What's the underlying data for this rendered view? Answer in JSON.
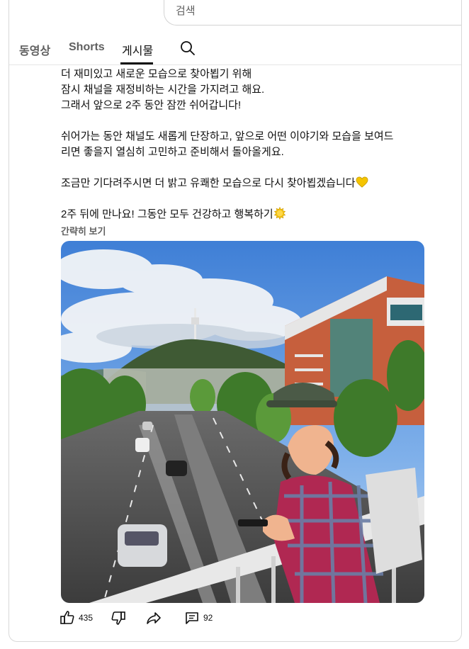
{
  "search": {
    "placeholder": "검색"
  },
  "tabs": [
    {
      "label": "동영상",
      "active": false
    },
    {
      "label": "Shorts",
      "active": false
    },
    {
      "label": "게시물",
      "active": true
    }
  ],
  "post": {
    "paragraph1": "더 재미있고 새로운 모습으로 찾아뵙기 위해\n잠시 채널을 재정비하는 시간을 가지려고 해요.\n그래서 앞으로 2주 동안 잠깐 쉬어갑니다!",
    "paragraph2": "쉬어가는 동안 채널도 새롭게 단장하고, 앞으로 어떤 이야기와 모습을 보여드\n리면 좋을지 열심히 고민하고 준비해서 돌아올게요.",
    "paragraph3": "조금만 기다려주시면 더 밝고 유쾌한 모습으로 다시 찾아뵙겠습니다",
    "paragraph4": "2주 뒤에 만나요! 그동안 모두 건강하고 행복하기",
    "read_less": "간략히 보기"
  },
  "actions": {
    "like_count": "435",
    "comment_count": "92"
  },
  "colors": {
    "accent_heart": "#f5c400",
    "sun": "#f4c20d",
    "text_primary": "#0f0f0f",
    "text_secondary": "#606060"
  },
  "icons": [
    "search-icon",
    "thumbs-up-icon",
    "thumbs-down-icon",
    "share-icon",
    "comment-icon",
    "yellow-heart-emoji",
    "sun-emoji"
  ]
}
